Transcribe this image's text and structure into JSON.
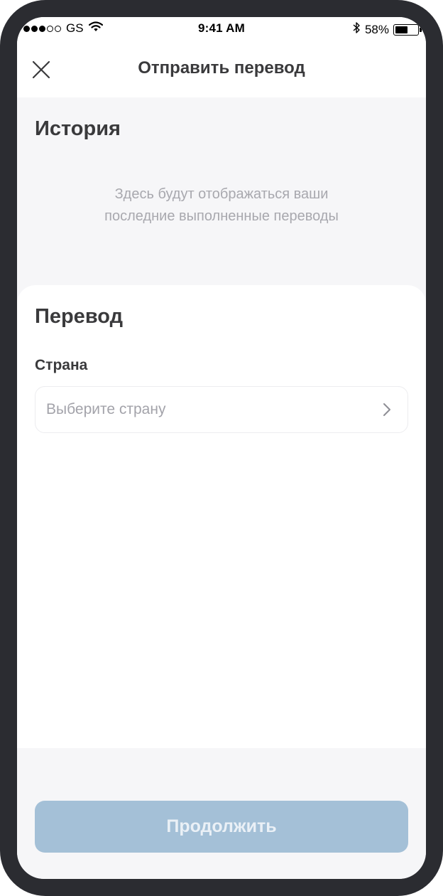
{
  "status_bar": {
    "carrier": "GS",
    "time": "9:41 AM",
    "battery": "58%",
    "battery_level": 0.58,
    "signal_filled": 3,
    "signal_total": 5,
    "icons": [
      "signal-dots-icon",
      "wifi-icon",
      "bluetooth-icon",
      "battery-icon"
    ]
  },
  "nav": {
    "title": "Отправить перевод",
    "close_icon": "close-icon"
  },
  "history": {
    "title": "История",
    "empty_line1": "Здесь будут отображаться ваши",
    "empty_line2": "последние выполненные переводы"
  },
  "transfer": {
    "title": "Перевод",
    "country_label": "Страна",
    "country_placeholder": "Выберите страну",
    "country_icon": "chevron-right-icon"
  },
  "footer": {
    "continue_label": "Продолжить"
  },
  "colors": {
    "device_frame": "#2b2c31",
    "background": "#f6f6f8",
    "card": "#ffffff",
    "text_primary": "#3a3a3c",
    "text_muted": "#a8a8ae",
    "button_disabled": "#a4c0d7",
    "button_text": "#eaf0f6"
  }
}
